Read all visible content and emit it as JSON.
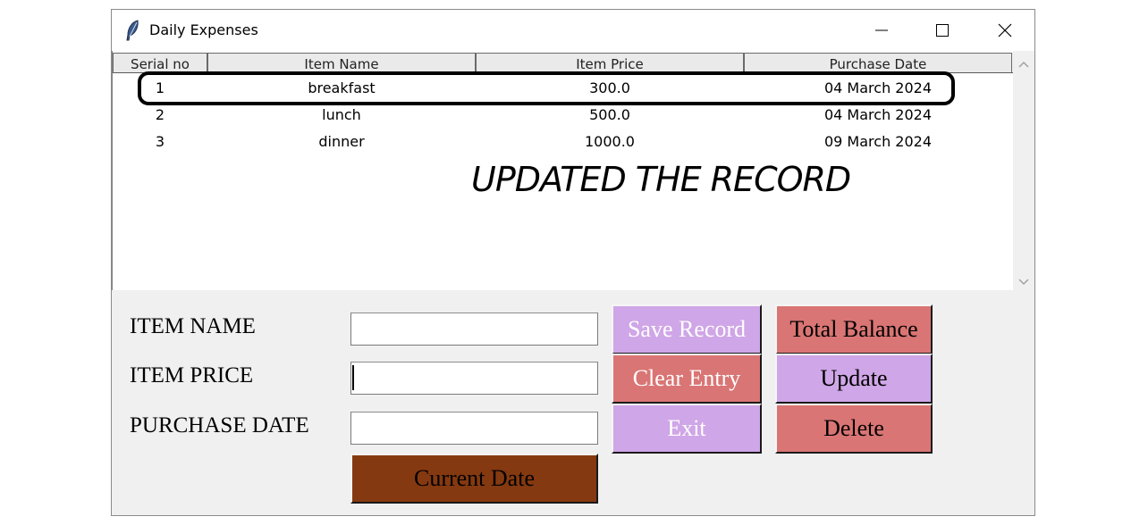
{
  "window": {
    "title": "Daily Expenses",
    "icon": "feather-icon"
  },
  "table": {
    "columns": [
      "Serial no",
      "Item Name",
      "Item Price",
      "Purchase Date"
    ],
    "rows": [
      {
        "serial": "1",
        "name": "breakfast",
        "price": "300.0",
        "date": "04 March 2024"
      },
      {
        "serial": "2",
        "name": "lunch",
        "price": "500.0",
        "date": "04 March 2024"
      },
      {
        "serial": "3",
        "name": "dinner",
        "price": "1000.0",
        "date": "09 March 2024"
      }
    ],
    "highlighted_row": 0
  },
  "annotation": "UPDATED THE RECORD",
  "form": {
    "item_name_label": "ITEM NAME",
    "item_price_label": "ITEM PRICE",
    "purchase_date_label": "PURCHASE DATE",
    "item_name_value": "",
    "item_price_value": "",
    "purchase_date_value": ""
  },
  "buttons": {
    "save_record": "Save Record",
    "clear_entry": "Clear Entry",
    "exit": "Exit",
    "total_balance": "Total Balance",
    "update": "Update",
    "delete": "Delete",
    "current_date": "Current Date"
  },
  "colors": {
    "purple_button": "#cfa6e7",
    "red_button": "#d97574",
    "brown_button": "#853910",
    "save_record_text": "#ffffff",
    "clear_entry_text": "#ffffff",
    "exit_text": "#ffffff",
    "dark_text": "#000000"
  }
}
